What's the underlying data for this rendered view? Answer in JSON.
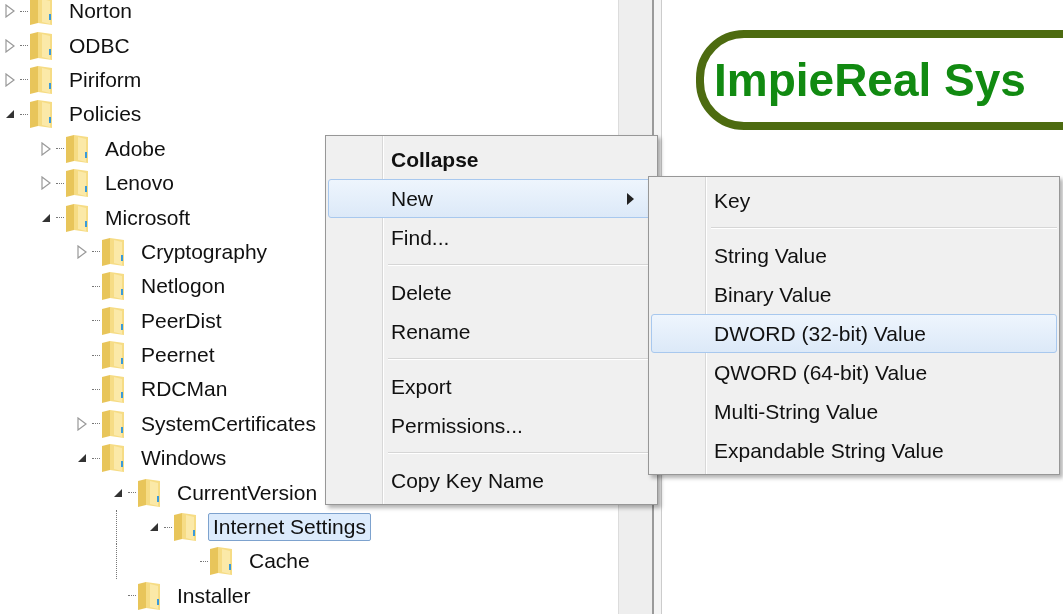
{
  "tree": [
    {
      "label": "Norton",
      "expanded": false
    },
    {
      "label": "ODBC",
      "expanded": false
    },
    {
      "label": "Piriform",
      "expanded": false
    },
    {
      "label": "Policies",
      "expanded": true,
      "children": [
        {
          "label": "Adobe",
          "expanded": false
        },
        {
          "label": "Lenovo",
          "expanded": false
        },
        {
          "label": "Microsoft",
          "expanded": true,
          "children": [
            {
              "label": "Cryptography",
              "expanded": false
            },
            {
              "label": "Netlogon"
            },
            {
              "label": "PeerDist"
            },
            {
              "label": "Peernet"
            },
            {
              "label": "RDCMan"
            },
            {
              "label": "SystemCertificates",
              "expanded": false
            },
            {
              "label": "Windows",
              "expanded": true,
              "children": [
                {
                  "label": "CurrentVersion",
                  "expanded": true,
                  "children": [
                    {
                      "label": "Internet Settings",
                      "expanded": true,
                      "selected": true,
                      "children": [
                        {
                          "label": "Cache"
                        }
                      ]
                    }
                  ]
                },
                {
                  "label": "Installer"
                }
              ]
            }
          ]
        }
      ]
    }
  ],
  "logo": {
    "text": "ImpieReal Sys"
  },
  "context_menu": [
    {
      "label": "Collapse",
      "bold": true,
      "selected": false
    },
    {
      "label": "New",
      "submenu": true,
      "selected": true
    },
    {
      "label": "Find...",
      "selected": false
    },
    {
      "label": "Delete",
      "separator_before": true,
      "selected": false
    },
    {
      "label": "Rename",
      "selected": false
    },
    {
      "label": "Export",
      "separator_before": true,
      "selected": false
    },
    {
      "label": "Permissions...",
      "selected": false
    },
    {
      "label": "Copy Key Name",
      "separator_before": true,
      "selected": false
    }
  ],
  "submenu": [
    {
      "label": "Key",
      "selected": false
    },
    {
      "label": "String Value",
      "separator_before": true,
      "selected": false
    },
    {
      "label": "Binary Value",
      "selected": false
    },
    {
      "label": "DWORD (32-bit) Value",
      "selected": true
    },
    {
      "label": "QWORD (64-bit) Value",
      "selected": false
    },
    {
      "label": "Multi-String Value",
      "selected": false
    },
    {
      "label": "Expandable String Value",
      "selected": false
    }
  ]
}
